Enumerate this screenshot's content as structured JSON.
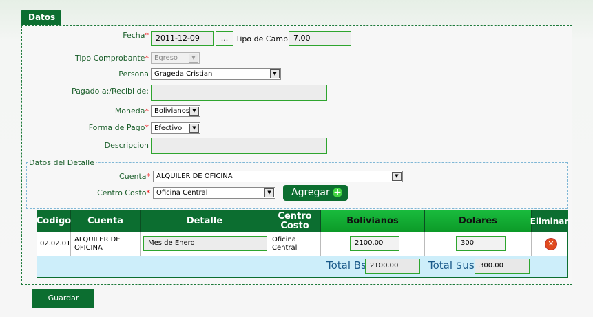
{
  "tab": {
    "title": "Datos"
  },
  "form": {
    "fecha": {
      "label": "Fecha",
      "value": "2011-12-09",
      "picker_label": "..."
    },
    "tipo_cambio": {
      "label": "Tipo de Cambio",
      "value": "7.00"
    },
    "tipo_comprobante": {
      "label": "Tipo Comprobante",
      "value": "Egreso"
    },
    "persona": {
      "label": "Persona",
      "value": "Grageda Cristian"
    },
    "pagado": {
      "label": "Pagado a:/Recibi de:",
      "value": ""
    },
    "moneda": {
      "label": "Moneda",
      "value": "Bolivianos"
    },
    "forma_pago": {
      "label": "Forma de Pago",
      "value": "Efectivo"
    },
    "descripcion": {
      "label": "Descripcion",
      "value": ""
    },
    "required_mark": "*"
  },
  "detalle": {
    "legend": "Datos del Detalle",
    "cuenta": {
      "label": "Cuenta",
      "value": "ALQUILER DE OFICINA"
    },
    "centro_costo": {
      "label": "Centro Costo",
      "value": "Oficina Central"
    },
    "agregar_label": "Agregar"
  },
  "grid": {
    "headers": {
      "codigo": "Codigo",
      "cuenta": "Cuenta",
      "detalle": "Detalle",
      "centro_costo": "Centro Costo",
      "bolivianos": "Bolivianos",
      "dolares": "Dolares",
      "eliminar": "Eliminar"
    },
    "rows": [
      {
        "codigo": "02.02.01",
        "cuenta": "ALQUILER DE OFICINA",
        "detalle": "Mes de Enero",
        "centro_costo": "Oficina Central",
        "bolivianos": "2100.00",
        "dolares": "300"
      }
    ],
    "totals": {
      "bs_label": "Total Bs",
      "bs_value": "2100.00",
      "us_label": "Total $us",
      "us_value": "300.00"
    }
  },
  "guardar_label": "Guardar",
  "colors": {
    "accent": "#0c6e30",
    "required": "#e11111",
    "total_row": "#cdeefa"
  }
}
